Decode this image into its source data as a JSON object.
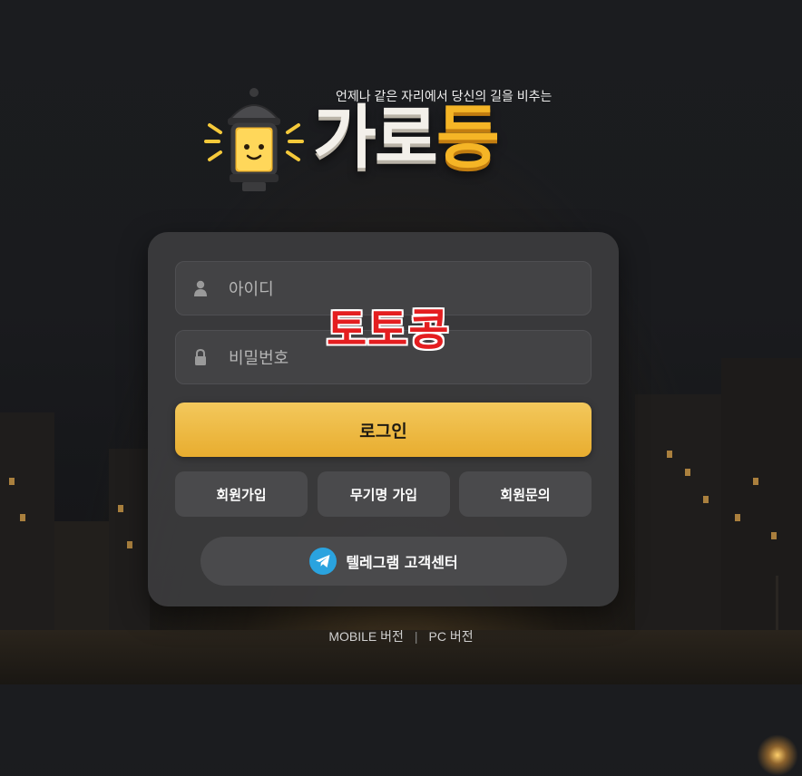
{
  "header": {
    "tagline": "언제나 같은 자리에서 당신의 길을 비추는",
    "logo_part1": "가로",
    "logo_part2": "등"
  },
  "login_form": {
    "username_placeholder": "아이디",
    "password_placeholder": "비밀번호",
    "login_label": "로그인",
    "signup_label": "회원가입",
    "anonymous_signup_label": "무기명 가입",
    "inquiry_label": "회원문의",
    "telegram_label": "텔레그램 고객센터"
  },
  "watermark": "토토콩",
  "footer": {
    "mobile_label": "MOBILE 버전",
    "separator": "|",
    "pc_label": "PC 버전"
  },
  "colors": {
    "accent": "#f0bb45",
    "card_bg": "#3c3c3e",
    "telegram": "#2aa3df",
    "watermark": "#e41e20"
  }
}
